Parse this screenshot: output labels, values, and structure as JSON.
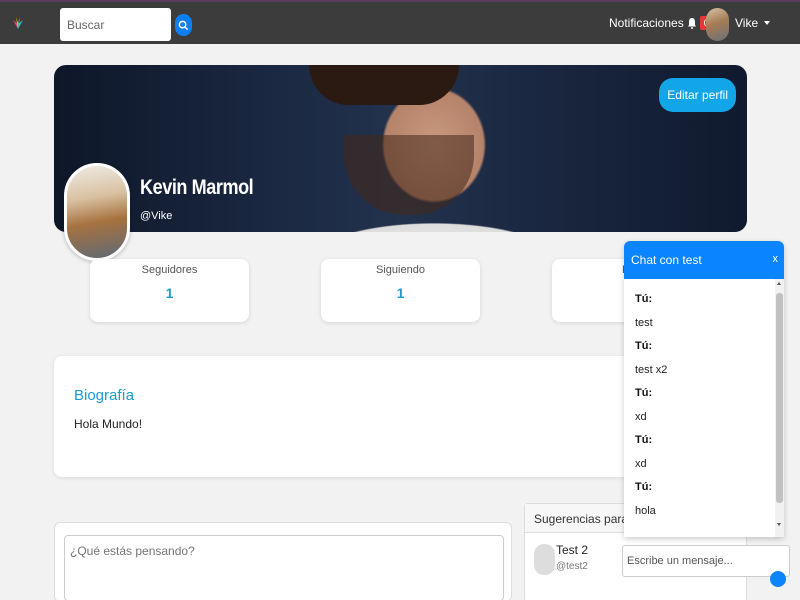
{
  "nav": {
    "search_placeholder": "Buscar",
    "notifications_label": "Notificaciones",
    "notifications_count": "0",
    "user_name": "Vike"
  },
  "profile": {
    "edit_label": "Editar perfil",
    "name": "Kevin Marmol",
    "username": "@Vike"
  },
  "stats": [
    {
      "label": "Seguidores",
      "value": "1"
    },
    {
      "label": "Siguiendo",
      "value": "1"
    },
    {
      "label": "P",
      "value": ""
    }
  ],
  "bio": {
    "title": "Biografía",
    "text": "Hola Mundo!"
  },
  "post": {
    "placeholder": "¿Qué estás pensando?"
  },
  "suggestions": {
    "title": "Sugerencias para ti",
    "items": [
      {
        "name": "Test 2",
        "username": "@test2"
      }
    ]
  },
  "chat": {
    "title": "Chat con test",
    "close_label": "x",
    "messages": [
      {
        "from": "Tú:",
        "text": "test"
      },
      {
        "from": "Tú:",
        "text": "test x2"
      },
      {
        "from": "Tú:",
        "text": "xd"
      },
      {
        "from": "Tú:",
        "text": "xd"
      },
      {
        "from": "Tú:",
        "text": "hola"
      }
    ],
    "input_placeholder": "Escribe un mensaje..."
  },
  "colors": {
    "navbar": "#3c3c3c",
    "accent": "#1a9ccf",
    "chat_header": "#0a84ff",
    "badge": "#e53935"
  }
}
